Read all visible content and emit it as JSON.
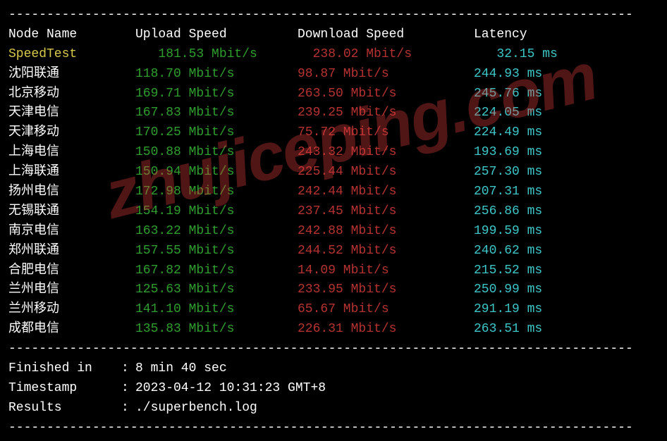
{
  "headers": {
    "node": "Node Name",
    "upload": "Upload Speed",
    "download": "Download Speed",
    "latency": "Latency"
  },
  "speedtest_row": {
    "name": "SpeedTest",
    "upload": "181.53 Mbit/s",
    "download": "238.02 Mbit/s",
    "latency": "32.15 ms"
  },
  "rows": [
    {
      "name": "沈阳联通",
      "upload": "118.70 Mbit/s",
      "download": "98.87 Mbit/s",
      "latency": "244.93 ms"
    },
    {
      "name": "北京移动",
      "upload": "169.71 Mbit/s",
      "download": "263.50 Mbit/s",
      "latency": "245.76 ms"
    },
    {
      "name": "天津电信",
      "upload": "167.83 Mbit/s",
      "download": "239.25 Mbit/s",
      "latency": "224.05 ms"
    },
    {
      "name": "天津移动",
      "upload": "170.25 Mbit/s",
      "download": "75.72 Mbit/s",
      "latency": "224.49 ms"
    },
    {
      "name": "上海电信",
      "upload": "150.88 Mbit/s",
      "download": "243.32 Mbit/s",
      "latency": "193.69 ms"
    },
    {
      "name": "上海联通",
      "upload": "150.94 Mbit/s",
      "download": "225.44 Mbit/s",
      "latency": "257.30 ms"
    },
    {
      "name": "扬州电信",
      "upload": "172.98 Mbit/s",
      "download": "242.44 Mbit/s",
      "latency": "207.31 ms"
    },
    {
      "name": "无锡联通",
      "upload": "154.19 Mbit/s",
      "download": "237.45 Mbit/s",
      "latency": "256.86 ms"
    },
    {
      "name": "南京电信",
      "upload": "163.22 Mbit/s",
      "download": "242.88 Mbit/s",
      "latency": "199.59 ms"
    },
    {
      "name": "郑州联通",
      "upload": "157.55 Mbit/s",
      "download": "244.52 Mbit/s",
      "latency": "240.62 ms"
    },
    {
      "name": "合肥电信",
      "upload": "167.82 Mbit/s",
      "download": "14.09 Mbit/s",
      "latency": "215.52 ms"
    },
    {
      "name": "兰州电信",
      "upload": "125.63 Mbit/s",
      "download": "233.95 Mbit/s",
      "latency": "250.99 ms"
    },
    {
      "name": "兰州移动",
      "upload": "141.10 Mbit/s",
      "download": "65.67 Mbit/s",
      "latency": "291.19 ms"
    },
    {
      "name": "成都电信",
      "upload": "135.83 Mbit/s",
      "download": "226.31 Mbit/s",
      "latency": "263.51 ms"
    }
  ],
  "footer": {
    "finished_label": "Finished in",
    "finished_value": "8 min 40 sec",
    "timestamp_label": "Timestamp",
    "timestamp_value": "2023-04-12 10:31:23 GMT+8",
    "results_label": "Results",
    "results_value": "./superbench.log"
  },
  "divider": "----------------------------------------------------------------------------------",
  "watermark": "zhujiceping.com"
}
